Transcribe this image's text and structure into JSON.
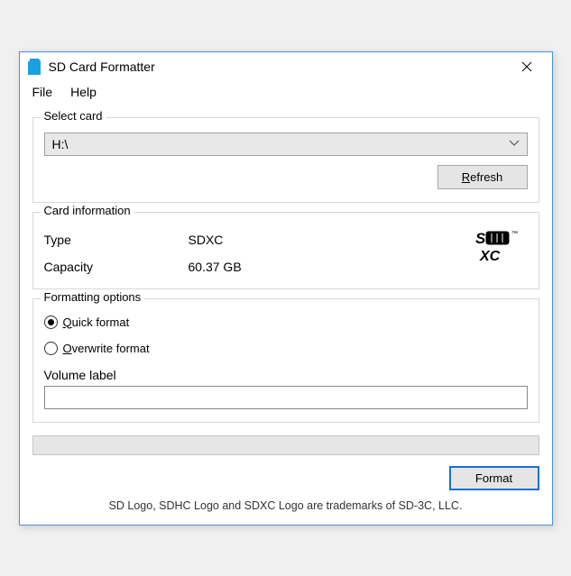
{
  "window": {
    "title": "SD Card Formatter"
  },
  "menu": {
    "file": "File",
    "help": "Help"
  },
  "select_card": {
    "legend": "Select card",
    "value": "H:\\",
    "refresh_html": "<u>R</u>efresh"
  },
  "card_info": {
    "legend": "Card information",
    "type_label": "Type",
    "type_value": "SDXC",
    "capacity_label": "Capacity",
    "capacity_value": "60.37 GB"
  },
  "formatting": {
    "legend": "Formatting options",
    "quick_html": "<u>Q</u>uick format",
    "overwrite_html": "<u>O</u>verwrite format",
    "volume_label": "Volume label",
    "volume_value": ""
  },
  "actions": {
    "format": "Format"
  },
  "footer": "SD Logo, SDHC Logo and SDXC Logo are trademarks of SD-3C, LLC."
}
